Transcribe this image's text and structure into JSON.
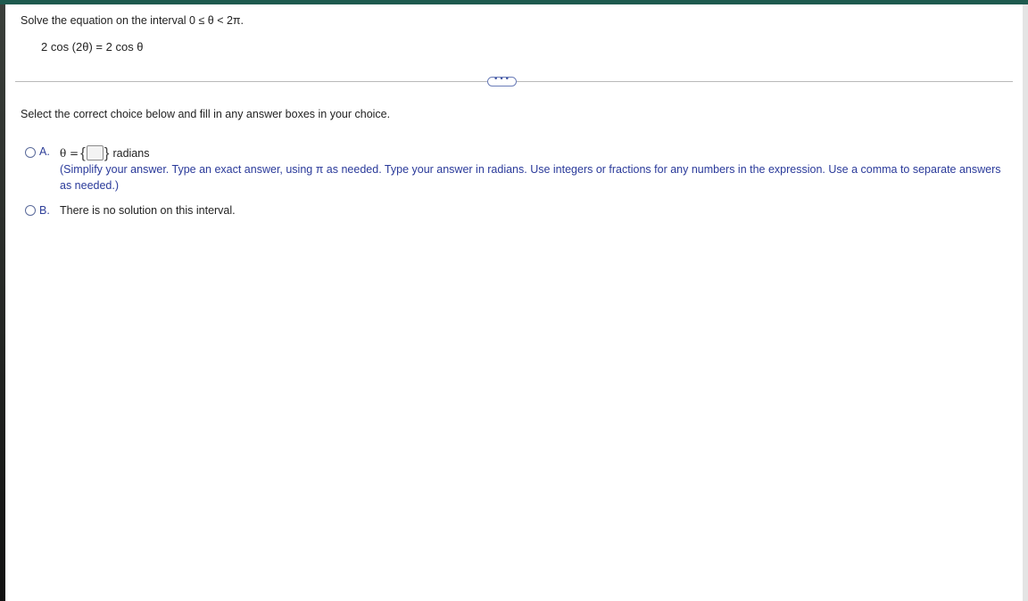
{
  "question": {
    "instruction": "Solve the equation on the interval 0 ≤ θ < 2π.",
    "equation": "2 cos (2θ) = 2 cos θ"
  },
  "more_button": {
    "label": "•••"
  },
  "prompt": "Select the correct choice below and fill in any answer boxes in your choice.",
  "choices": [
    {
      "letter": "A.",
      "answer_prefix": "θ =",
      "brace_open": "{",
      "brace_close": "}",
      "answer_value": "",
      "unit": "radians",
      "hint": "(Simplify your answer. Type an exact answer, using π as needed. Type your answer in radians. Use integers or fractions for any numbers in the expression. Use a comma to separate answers as needed.)"
    },
    {
      "letter": "B.",
      "text": "There is no solution on this interval."
    }
  ],
  "colors": {
    "top_bar": "#1e5a4e",
    "choice_letter": "#2f3f99",
    "hint_text": "#2a3a9a"
  }
}
